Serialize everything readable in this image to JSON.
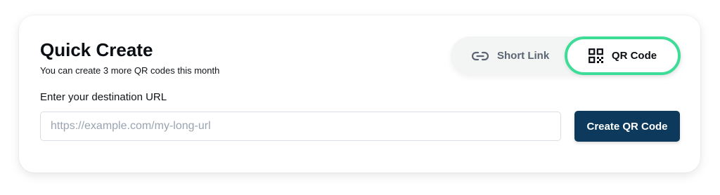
{
  "quick_create": {
    "title": "Quick Create",
    "subtitle": "You can create 3 more QR codes this month"
  },
  "mode_toggle": {
    "options": [
      {
        "label": "Short Link",
        "icon": "link-icon",
        "selected": false
      },
      {
        "label": "QR Code",
        "icon": "qr-code-icon",
        "selected": true
      }
    ]
  },
  "url_form": {
    "label": "Enter your destination URL",
    "placeholder": "https://example.com/my-long-url",
    "value": "",
    "submit_label": "Create QR Code"
  },
  "colors": {
    "accent_green": "#3ddc97",
    "button_navy": "#0d3a5c"
  }
}
